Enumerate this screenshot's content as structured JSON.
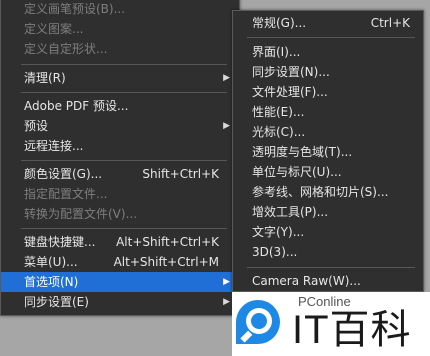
{
  "main_menu": {
    "items": [
      {
        "label": "定义画笔预设(B)...",
        "disabled": true
      },
      {
        "label": "定义图案...",
        "disabled": true
      },
      {
        "label": "定义自定形状...",
        "disabled": true
      },
      {
        "label": "清理(R)",
        "submenu": true
      },
      {
        "label": "Adobe PDF 预设..."
      },
      {
        "label": "预设",
        "submenu": true
      },
      {
        "label": "远程连接..."
      },
      {
        "label": "颜色设置(G)...",
        "shortcut": "Shift+Ctrl+K"
      },
      {
        "label": "指定配置文件...",
        "disabled": true
      },
      {
        "label": "转换为配置文件(V)...",
        "disabled": true
      },
      {
        "label": "键盘快捷键...",
        "shortcut": "Alt+Shift+Ctrl+K"
      },
      {
        "label": "菜单(U)...",
        "shortcut": "Alt+Shift+Ctrl+M"
      },
      {
        "label": "首选项(N)",
        "submenu": true,
        "highlighted": true
      },
      {
        "label": "同步设置(E)",
        "submenu": true
      }
    ]
  },
  "sub_menu": {
    "items": [
      {
        "label": "常规(G)...",
        "shortcut": "Ctrl+K"
      },
      {
        "label": "界面(I)..."
      },
      {
        "label": "同步设置(N)..."
      },
      {
        "label": "文件处理(F)..."
      },
      {
        "label": "性能(E)..."
      },
      {
        "label": "光标(C)..."
      },
      {
        "label": "透明度与色域(T)..."
      },
      {
        "label": "单位与标尺(U)..."
      },
      {
        "label": "参考线、网格和切片(S)..."
      },
      {
        "label": "增效工具(P)..."
      },
      {
        "label": "文字(Y)..."
      },
      {
        "label": "3D(3)..."
      },
      {
        "label": "Camera Raw(W)..."
      }
    ]
  },
  "watermark": {
    "top_text": "PConline",
    "brand_text": "IT百科"
  },
  "colors": {
    "menu_bg": "#2f2f2f",
    "highlight": "#1f6fd6",
    "disabled_text": "#7e7e7e"
  }
}
